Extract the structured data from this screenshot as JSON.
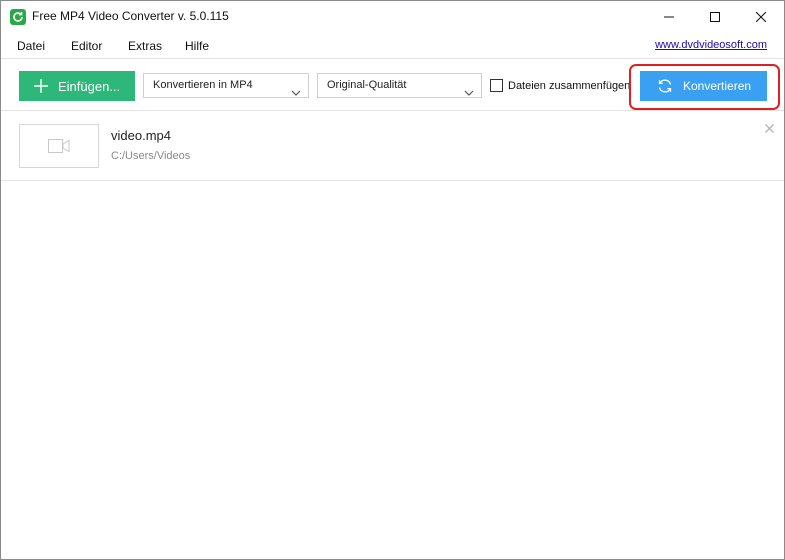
{
  "window": {
    "title": "Free MP4 Video Converter v. 5.0.115",
    "app_icon": "refresh-icon"
  },
  "menu": {
    "items": [
      "Datei",
      "Editor",
      "Extras",
      "Hilfe"
    ],
    "website": "www.dvdvideosoft.com"
  },
  "toolbar": {
    "add_label": "Einfügen...",
    "format_select": "Konvertieren in MP4",
    "quality_select": "Original-Qualität",
    "merge_label": "Dateien zusammenfügen",
    "merge_checked": false,
    "convert_label": "Konvertieren"
  },
  "files": [
    {
      "name": "video.mp4",
      "path": "C:/Users/Videos"
    }
  ],
  "colors": {
    "add_button": "#2db87a",
    "convert_button": "#3aa0f2",
    "highlight": "#e02020",
    "link": "#1a0dab"
  }
}
